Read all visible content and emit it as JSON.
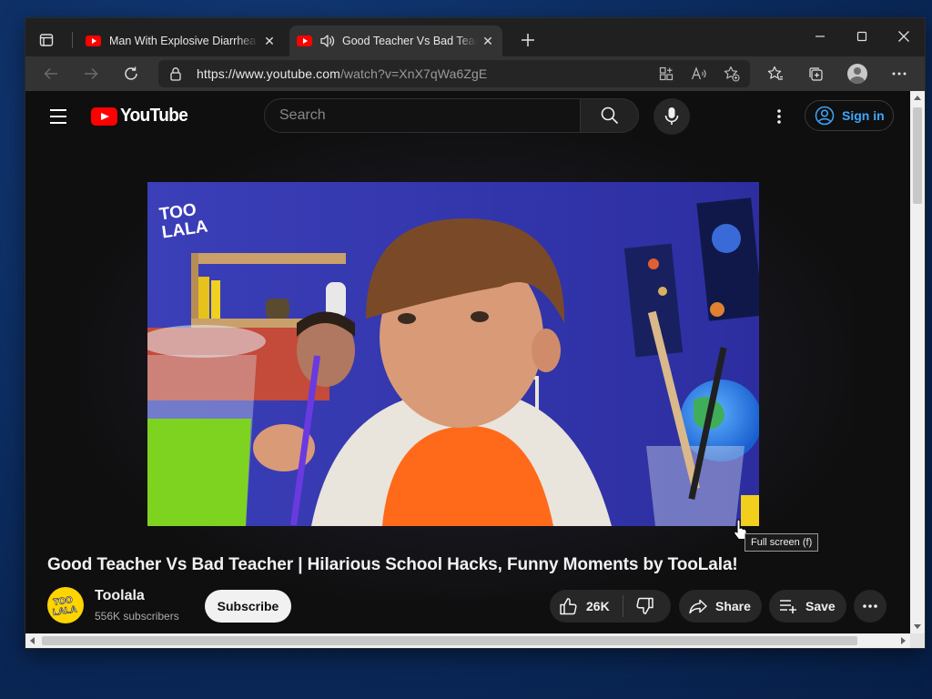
{
  "browser": {
    "tabs": [
      {
        "title": "Man With Explosive Diarrhea Mauls",
        "active": false,
        "favicon": "youtube-icon"
      },
      {
        "title": "Good Teacher Vs Bad Teacher",
        "active": true,
        "favicon": "youtube-icon",
        "audio": "speaker-icon"
      }
    ],
    "new_tab": "+",
    "url_host": "https://www.youtube.com",
    "url_path": "/watch?v=XnX7qWa6ZgE"
  },
  "youtube": {
    "logo_text": "YouTube",
    "search_placeholder": "Search",
    "sign_in": "Sign in"
  },
  "video": {
    "title": "Good Teacher Vs Bad Teacher | Hilarious School Hacks, Funny Moments by TooLala!",
    "channel": "Toolala",
    "subscribers": "556K subscribers",
    "subscribe_label": "Subscribe",
    "likes": "26K",
    "share_label": "Share",
    "save_label": "Save",
    "watermark_text": "TOO LALA",
    "tooltip": "Full screen (f)"
  },
  "colors": {
    "accent_blue": "#3ea6ff",
    "youtube_red": "#ff0000",
    "page_bg": "#0f0f0f",
    "tab_active_bg": "#333333"
  }
}
